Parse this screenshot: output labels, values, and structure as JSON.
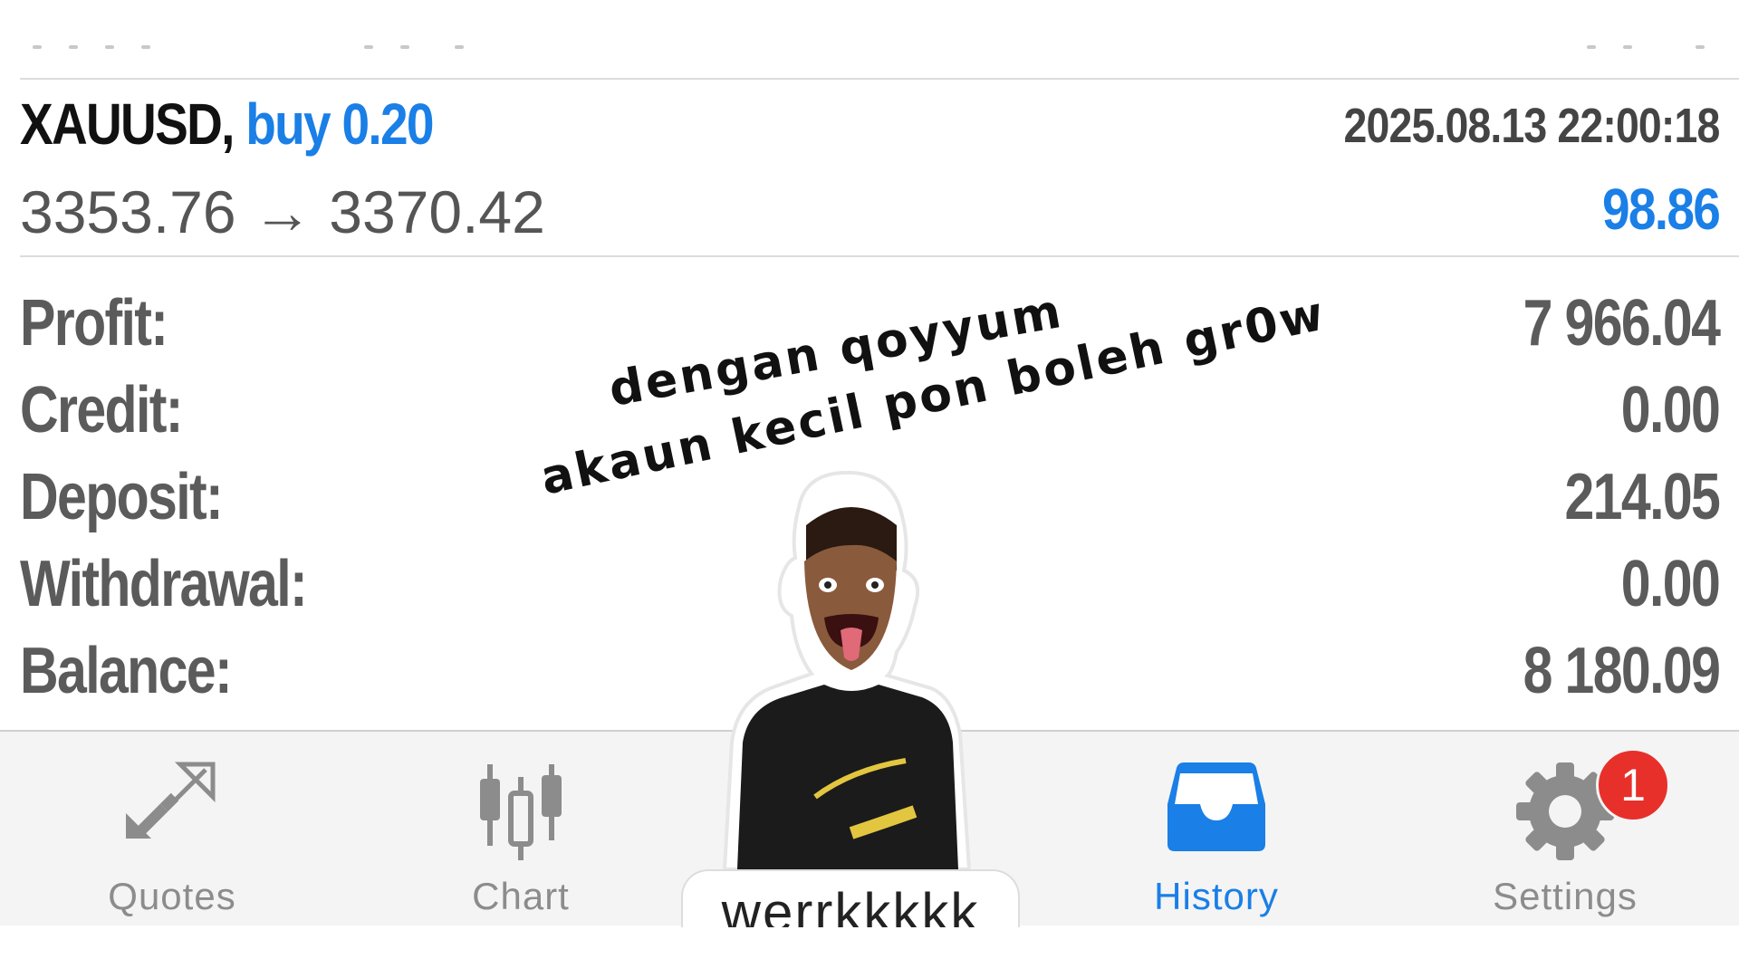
{
  "trade": {
    "symbol": "XAUUSD,",
    "direction": "buy 0.20",
    "timestamp": "2025.08.13 22:00:18",
    "open_price": "3353.76",
    "arrow": "→",
    "close_price": "3370.42",
    "profit": "98.86"
  },
  "summary": [
    {
      "label": "Profit:",
      "value": "7 966.04"
    },
    {
      "label": "Credit:",
      "value": "0.00"
    },
    {
      "label": "Deposit:",
      "value": "214.05"
    },
    {
      "label": "Withdrawal:",
      "value": "0.00"
    },
    {
      "label": "Balance:",
      "value": "8 180.09"
    }
  ],
  "tabs": [
    {
      "label": "Quotes",
      "icon": "quotes-icon",
      "active": false
    },
    {
      "label": "Chart",
      "icon": "chart-icon",
      "active": false
    },
    {
      "label": "History",
      "icon": "history-icon",
      "active": true
    },
    {
      "label": "Settings",
      "icon": "gear-icon",
      "active": false
    }
  ],
  "settings_badge": "1",
  "overlay": {
    "caption_line1": "dengan qoyyum",
    "caption_line2": "akaun kecil pon boleh gr0w",
    "sticker_text": "werrkkkkk"
  },
  "colors": {
    "accent": "#1a7fe6",
    "badge": "#e8302b",
    "muted": "#8c8c8c"
  }
}
